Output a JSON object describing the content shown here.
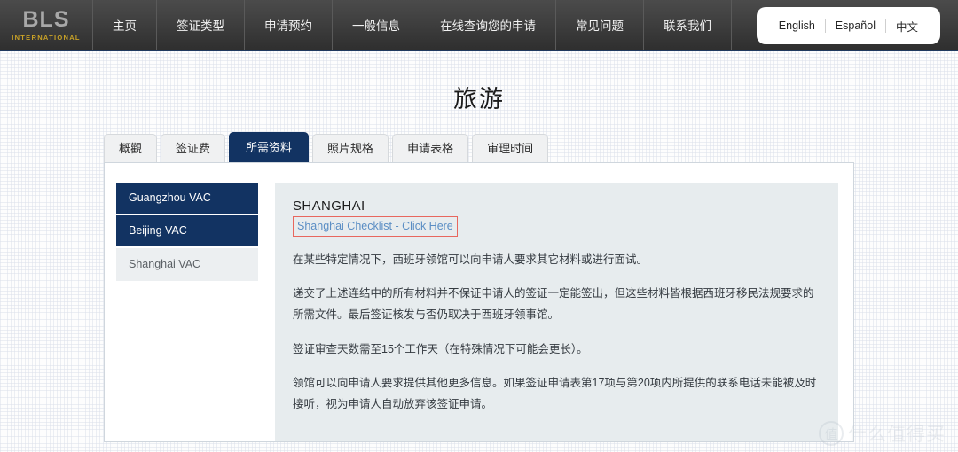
{
  "header": {
    "logo": {
      "brand": "BLS",
      "sub": "INTERNATIONAL"
    },
    "nav": [
      {
        "label": "主页"
      },
      {
        "label": "签证类型"
      },
      {
        "label": "申请预约"
      },
      {
        "label": "一般信息"
      },
      {
        "label": "在线查询您的申请"
      },
      {
        "label": "常见问题"
      },
      {
        "label": "联系我们"
      }
    ],
    "languages": [
      {
        "label": "English"
      },
      {
        "label": "Español"
      },
      {
        "label": "中文"
      }
    ]
  },
  "page": {
    "title": "旅游"
  },
  "tabs": [
    {
      "label": "概觀",
      "active": false
    },
    {
      "label": "签证费",
      "active": false
    },
    {
      "label": "所需资料",
      "active": true
    },
    {
      "label": "照片规格",
      "active": false
    },
    {
      "label": "申请表格",
      "active": false
    },
    {
      "label": "审理时间",
      "active": false
    }
  ],
  "sidebar": {
    "items": [
      {
        "label": "Guangzhou VAC",
        "state": "sel"
      },
      {
        "label": "Beijing VAC",
        "state": "sel"
      },
      {
        "label": "Shanghai VAC",
        "state": "unsel"
      }
    ]
  },
  "content": {
    "heading": "SHANGHAI",
    "checklist_link": "Shanghai Checklist - Click Here",
    "paragraphs": [
      "在某些特定情况下，西班牙领馆可以向申请人要求其它材料或进行面试。",
      "递交了上述连结中的所有材料并不保证申请人的签证一定能签出，但这些材料皆根据西班牙移民法规要求的所需文件。最后签证核发与否仍取决于西班牙领事馆。",
      "签证审查天数需至15个工作天（在特殊情况下可能会更长）。",
      "领馆可以向申请人要求提供其他更多信息。如果签证申请表第17项与第20项内所提供的联系电话未能被及时接听，视为申请人自动放弃该签证申请。"
    ]
  },
  "watermark": {
    "mark": "值",
    "text": "什么值得买"
  },
  "colors": {
    "nav_bg": "#3f3f3f",
    "accent_navy": "#123362",
    "link_blue": "#5b8ec4",
    "annotation_red": "#e8675e",
    "logo_gold": "#c9a227",
    "content_bg": "#e7ecee"
  }
}
